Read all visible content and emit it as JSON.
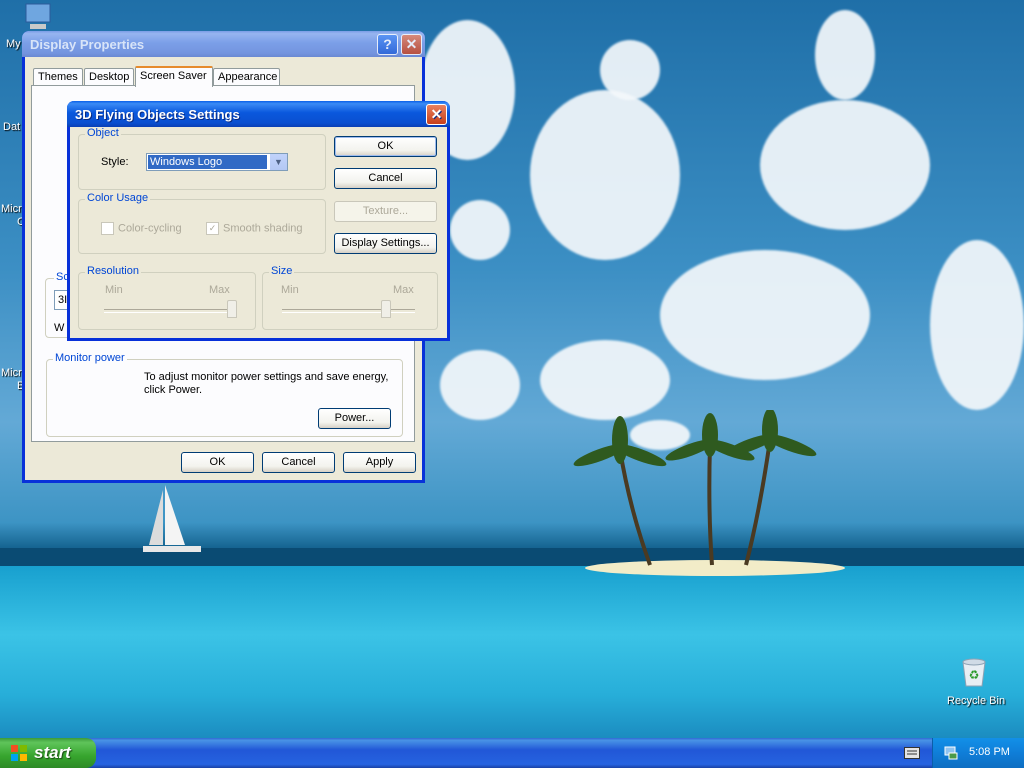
{
  "desktop": {
    "icons": [
      {
        "name": "my-computer",
        "label": "My"
      },
      {
        "name": "data",
        "label": "Dat"
      },
      {
        "name": "micro1",
        "label": "Micro"
      },
      {
        "name": "micro1b",
        "label": "C"
      },
      {
        "name": "micro2",
        "label": "Micro"
      },
      {
        "name": "micro2b",
        "label": "B"
      }
    ],
    "recycle_bin": "Recycle Bin"
  },
  "display_properties": {
    "title": "Display Properties",
    "tabs": [
      "Themes",
      "Desktop",
      "Screen Saver",
      "Appearance"
    ],
    "active_tab": "Screen Saver",
    "screensaver_group_label": "Sc",
    "screensaver_field_value": "3I",
    "wait_label": "W",
    "monitor_power": {
      "label": "Monitor power",
      "text": "To adjust monitor power settings and save energy, click Power.",
      "button": "Power..."
    },
    "buttons": {
      "ok": "OK",
      "cancel": "Cancel",
      "apply": "Apply"
    }
  },
  "settings_dialog": {
    "title": "3D Flying Objects Settings",
    "object_group": "Object",
    "style_label": "Style:",
    "style_value": "Windows Logo",
    "color_group": "Color Usage",
    "color_cycling": "Color-cycling",
    "smooth_shading": "Smooth shading",
    "resolution_group": "Resolution",
    "size_group": "Size",
    "min": "Min",
    "max": "Max",
    "resolution_level": 1.0,
    "size_level": 0.78,
    "buttons": {
      "ok": "OK",
      "cancel": "Cancel",
      "texture": "Texture...",
      "display_settings": "Display Settings..."
    }
  },
  "taskbar": {
    "start": "start",
    "clock": "5:08 PM"
  }
}
